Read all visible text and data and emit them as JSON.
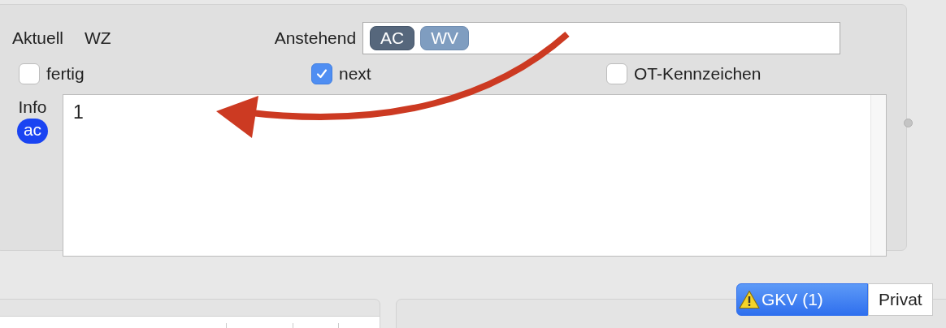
{
  "header": {
    "current_label": "Aktuell",
    "current_value": "WZ",
    "pending_label": "Anstehend",
    "pending_tokens": [
      {
        "label": "AC",
        "selected": true
      },
      {
        "label": "WV",
        "selected": false
      }
    ]
  },
  "checkboxes": [
    {
      "label": "fertig",
      "checked": false
    },
    {
      "label": "next",
      "checked": true
    },
    {
      "label": "OT-Kennzeichen",
      "checked": false
    }
  ],
  "info": {
    "label": "Info",
    "badge": "ac",
    "value": "1"
  },
  "segments": [
    {
      "label": "GKV (1)",
      "selected": true,
      "warning": true
    },
    {
      "label": "Privat",
      "selected": false,
      "warning": false
    }
  ]
}
